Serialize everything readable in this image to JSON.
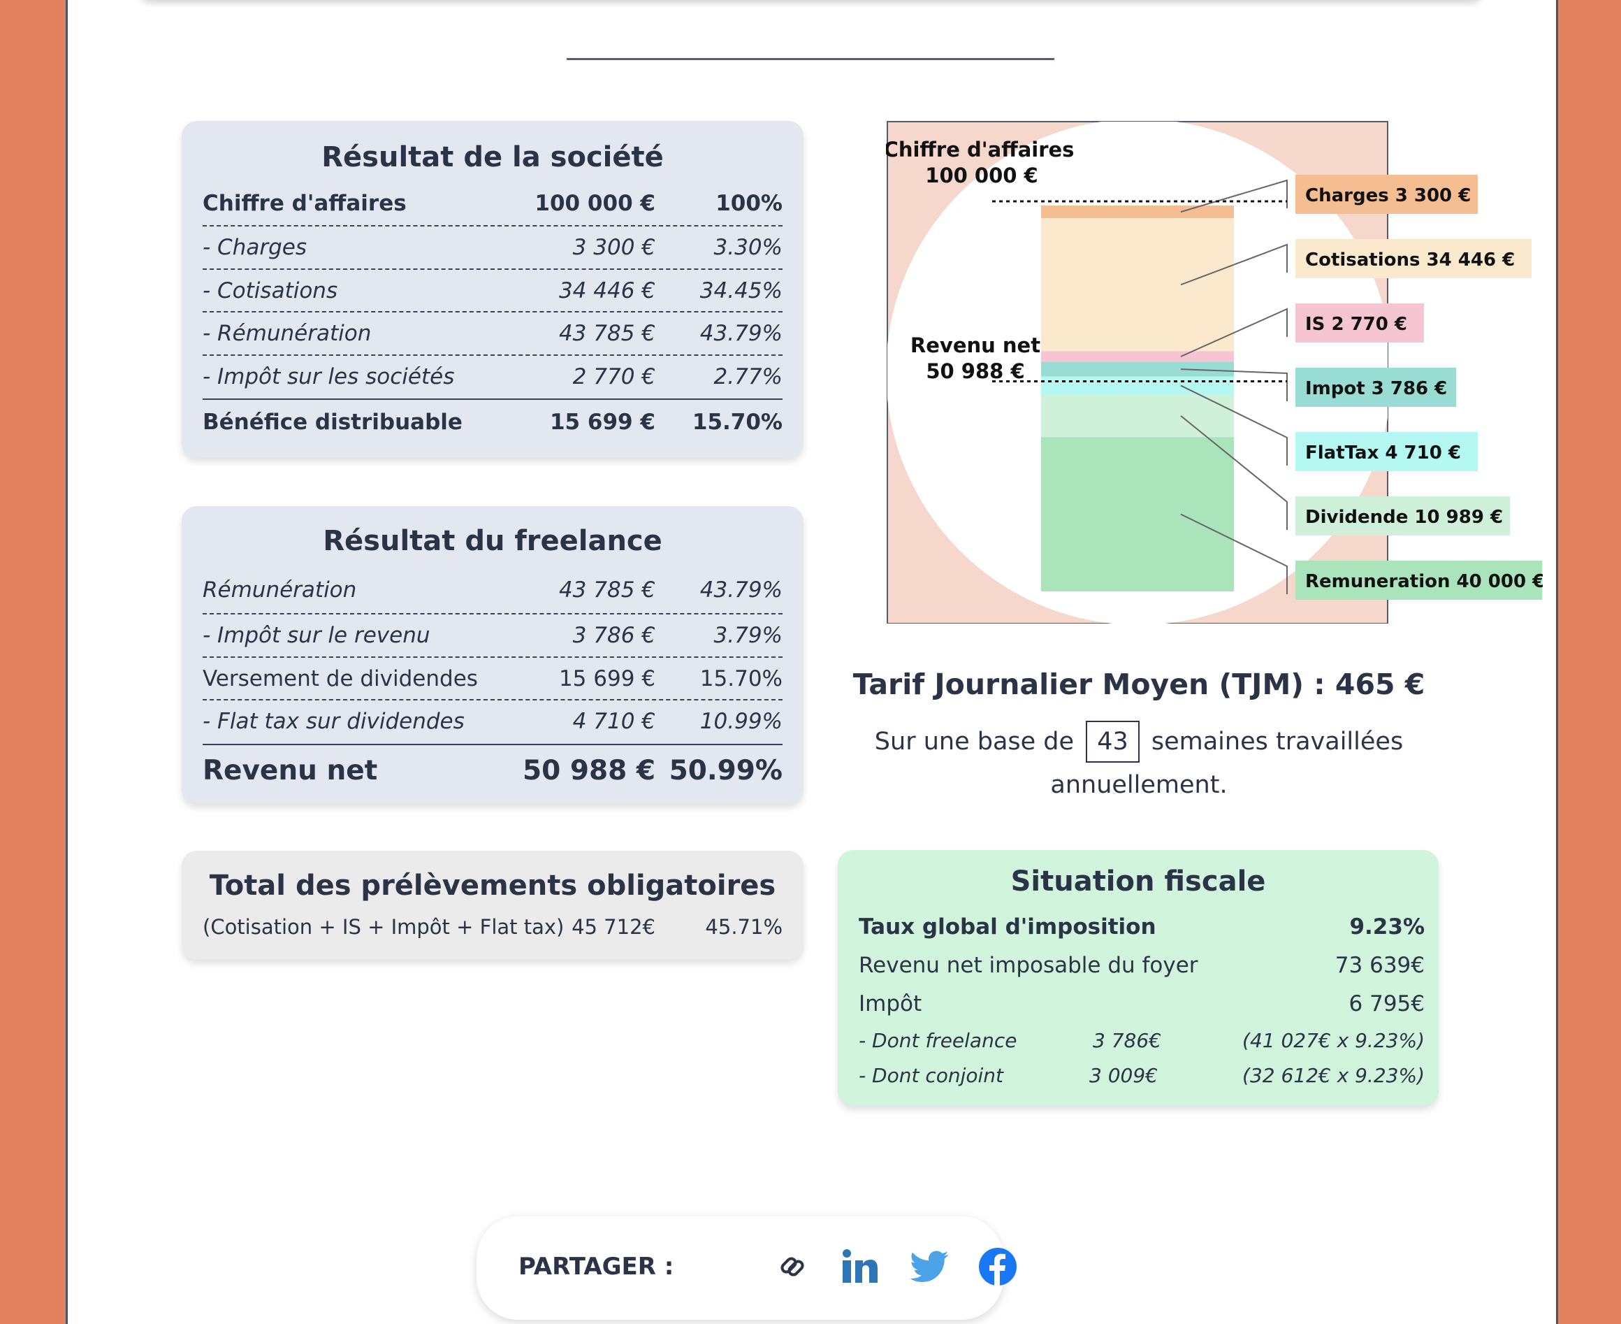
{
  "societe": {
    "title": "Résultat de la société",
    "rows": [
      {
        "label": "Chiffre d'affaires",
        "amount": "100 000 €",
        "pct": "100%"
      },
      {
        "label": "- Charges",
        "amount": "3 300 €",
        "pct": "3.30%"
      },
      {
        "label": "- Cotisations",
        "amount": "34 446 €",
        "pct": "34.45%"
      },
      {
        "label": "- Rémunération",
        "amount": "43 785 €",
        "pct": "43.79%"
      },
      {
        "label": "- Impôt sur les sociétés",
        "amount": "2 770 €",
        "pct": "2.77%"
      },
      {
        "label": "Bénéfice distribuable",
        "amount": "15 699 €",
        "pct": "15.70%"
      }
    ]
  },
  "freelance": {
    "title": "Résultat du freelance",
    "rows": [
      {
        "label": "Rémunération",
        "amount": "43 785 €",
        "pct": "43.79%"
      },
      {
        "label": "- Impôt sur le revenu",
        "amount": "3 786 €",
        "pct": "3.79%"
      },
      {
        "label": "Versement de dividendes",
        "amount": "15 699 €",
        "pct": "15.70%"
      },
      {
        "label": "- Flat tax sur dividendes",
        "amount": "4 710 €",
        "pct": "10.99%"
      },
      {
        "label": "Revenu net",
        "amount": "50 988 €",
        "pct": "50.99%"
      }
    ]
  },
  "prelevements": {
    "title": "Total des prélèvements obligatoires",
    "label": "(Cotisation + IS + Impôt + Flat tax)",
    "amount": "45 712€",
    "pct": "45.71%"
  },
  "chart": {
    "ca_label_1": "Chiffre d'affaires",
    "ca_label_2": "100 000 €",
    "net_label_1": "Revenu net",
    "net_label_2": "50 988 €",
    "segments": [
      {
        "label": "Charges 3 300 €",
        "value": 3300,
        "color": "#f4be92"
      },
      {
        "label": "Cotisations 34 446 €",
        "value": 34446,
        "color": "#fbe9ce"
      },
      {
        "label": "IS 2 770 €",
        "value": 2770,
        "color": "#f5c5d1"
      },
      {
        "label": "Impot 3 786 €",
        "value": 3786,
        "color": "#98dcd3"
      },
      {
        "label": "FlatTax 4 710 €",
        "value": 4710,
        "color": "#b5f7f1"
      },
      {
        "label": "Dividende 10 989 €",
        "value": 10989,
        "color": "#cff1d9"
      },
      {
        "label": "Remuneration 40 000 €",
        "value": 40000,
        "color": "#a9e4bb"
      }
    ]
  },
  "tjm": {
    "title": "Tarif Journalier Moyen (TJM) : 465 €",
    "prefix": "Sur une base de",
    "weeks": "43",
    "suffix_1": "semaines travaillées",
    "suffix_2": "annuellement."
  },
  "fiscal": {
    "title": "Situation fiscale",
    "taux_label": "Taux global d'imposition",
    "taux_value": "9.23%",
    "revenu_label": "Revenu net imposable du foyer",
    "revenu_value": "73 639€",
    "impot_label": "Impôt",
    "impot_value": "6 795€",
    "freelance_label": "- Dont freelance",
    "freelance_amount": "3 786€",
    "freelance_calc": "(41 027€ x 9.23%)",
    "conjoint_label": "- Dont conjoint",
    "conjoint_amount": "3 009€",
    "conjoint_calc": "(32 612€ x 9.23%)"
  },
  "share": {
    "label": "PARTAGER :",
    "icons": [
      "link-icon",
      "linkedin-icon",
      "twitter-icon",
      "facebook-icon"
    ]
  }
}
